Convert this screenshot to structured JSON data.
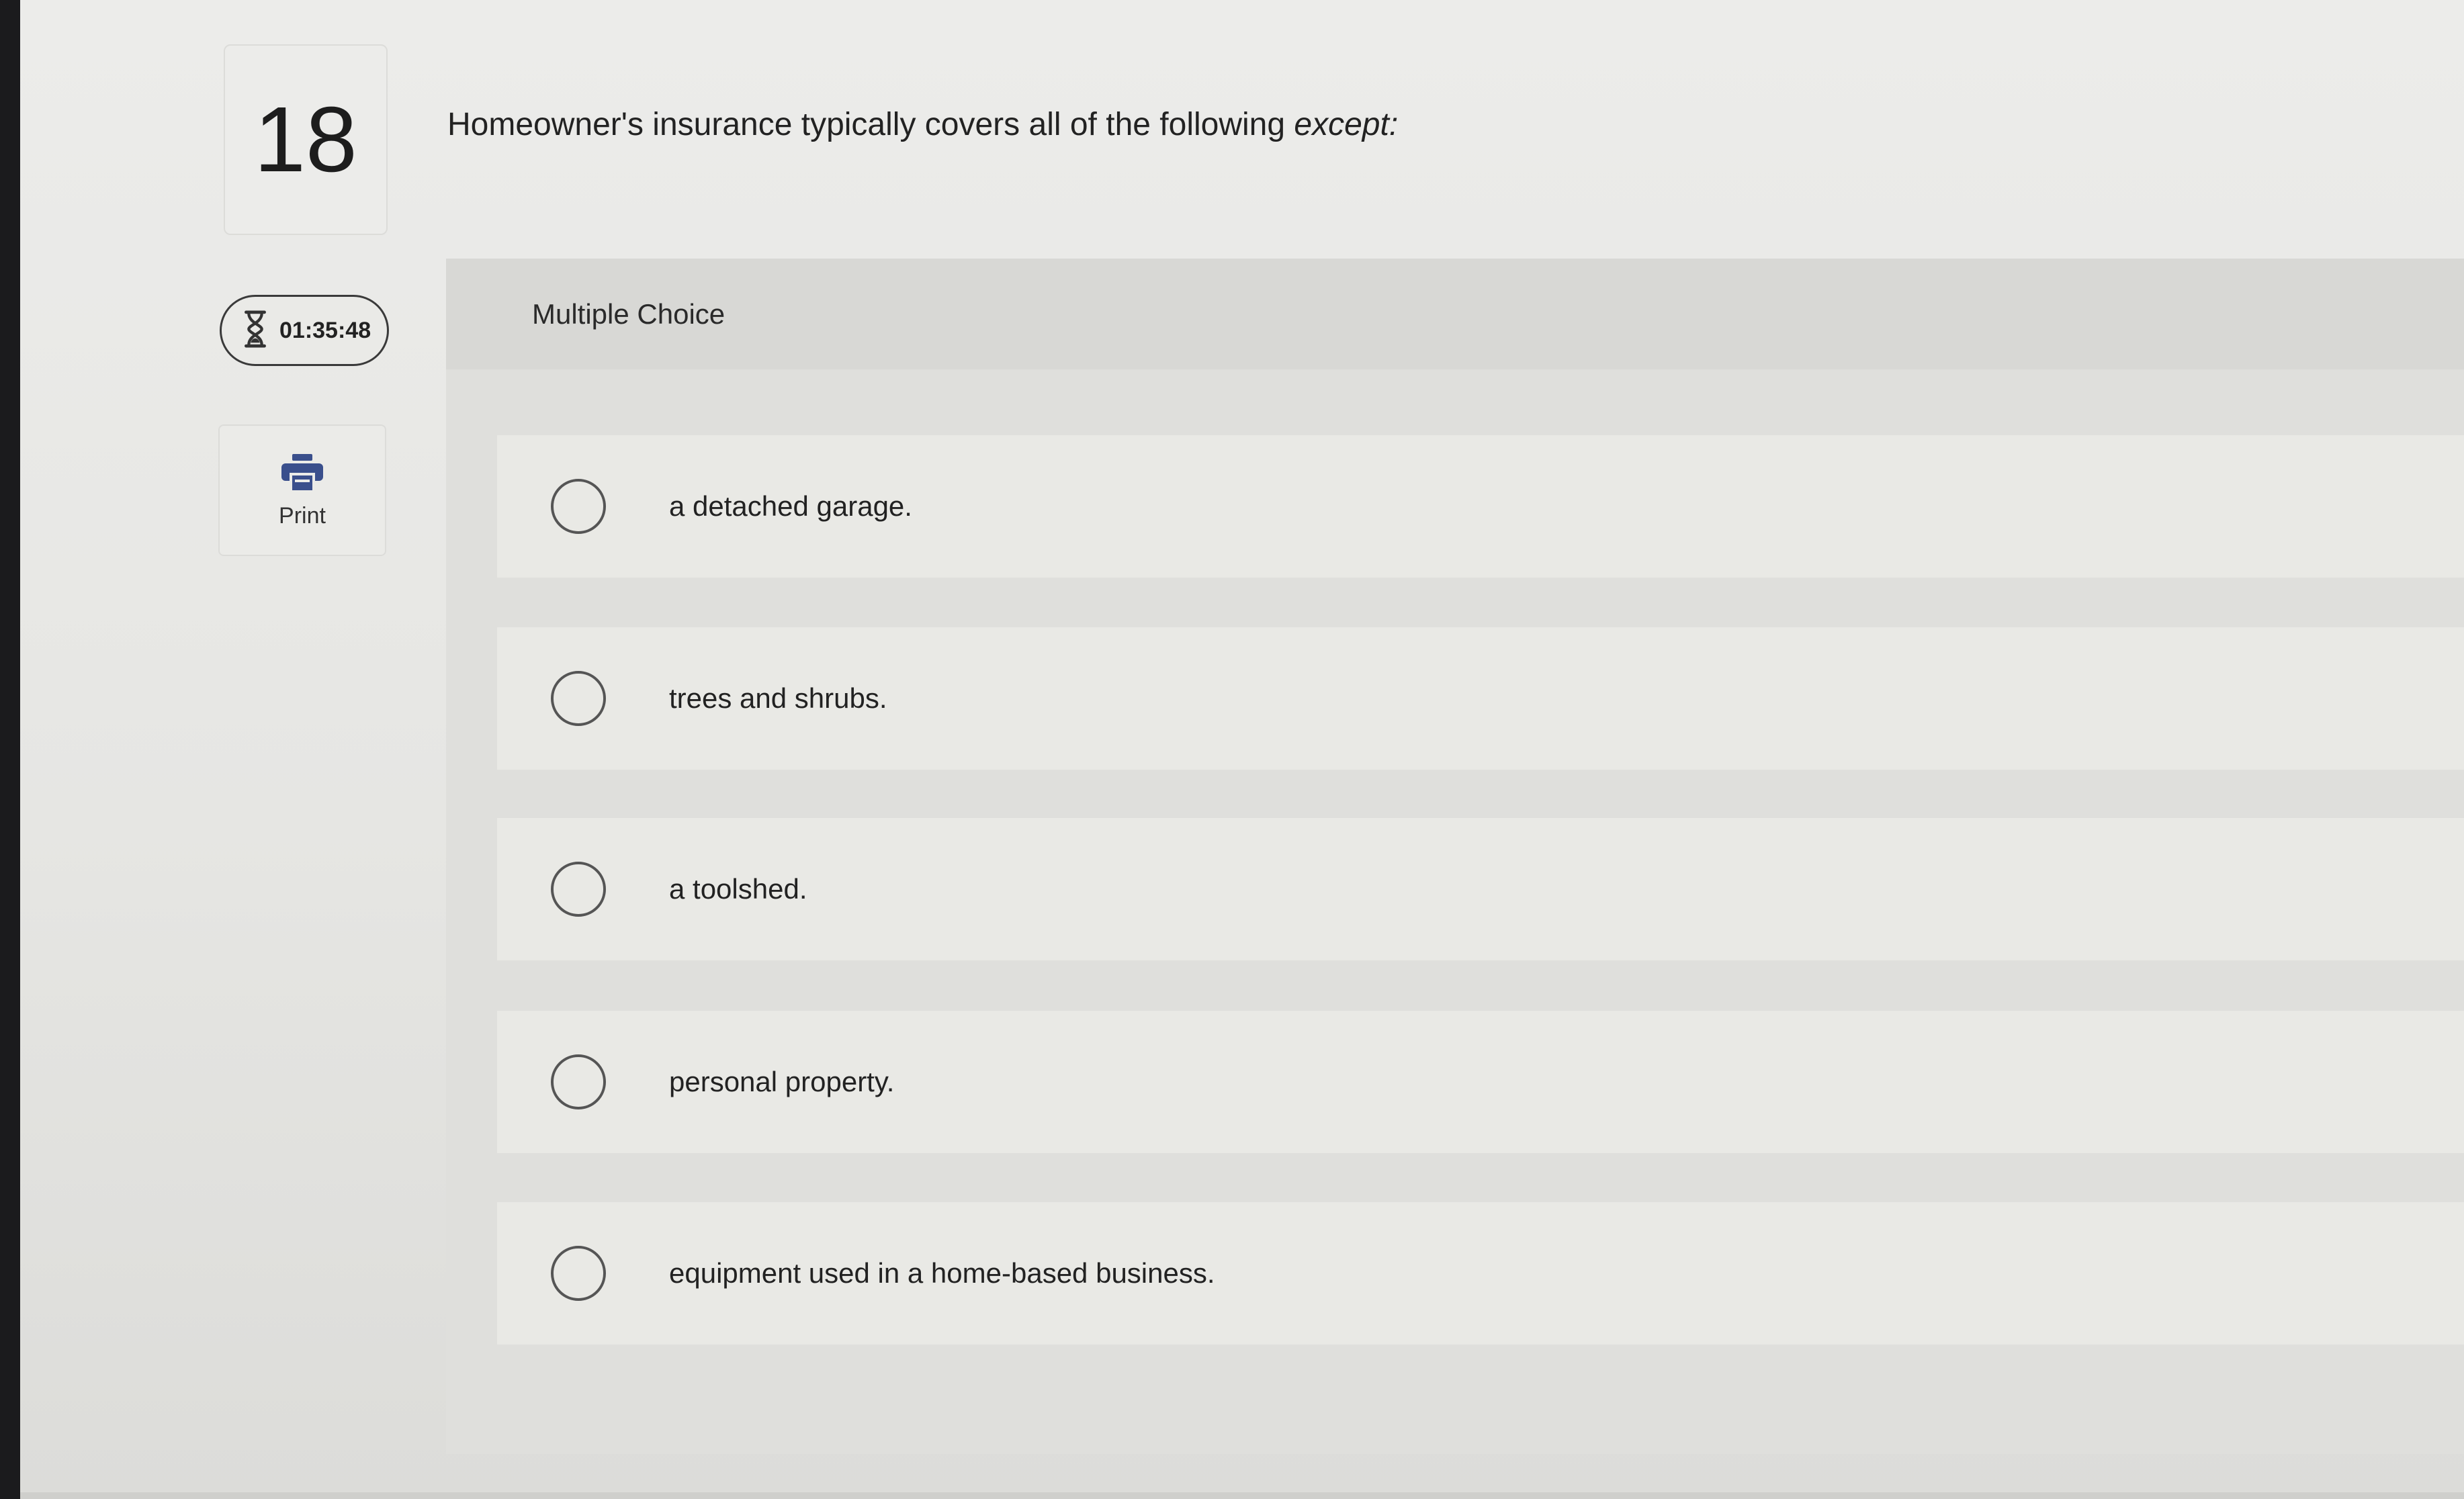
{
  "question": {
    "number": "18",
    "prompt_main": "Homeowner's insurance typically covers all of the following ",
    "prompt_emphasis": "except:"
  },
  "timer": {
    "value": "01:35:48",
    "icon": "hourglass-icon"
  },
  "print": {
    "label": "Print",
    "icon": "printer-icon"
  },
  "question_type": "Multiple Choice",
  "options": [
    {
      "text": "a detached garage."
    },
    {
      "text": "trees and shrubs."
    },
    {
      "text": "a toolshed."
    },
    {
      "text": "personal property."
    },
    {
      "text": "equipment used in a home-based business."
    }
  ],
  "colors": {
    "page_bg": "#e7e7e4",
    "panel_bg": "#dfdfdc",
    "option_bg": "#e9e9e5",
    "print_icon": "#3a4f8c"
  }
}
